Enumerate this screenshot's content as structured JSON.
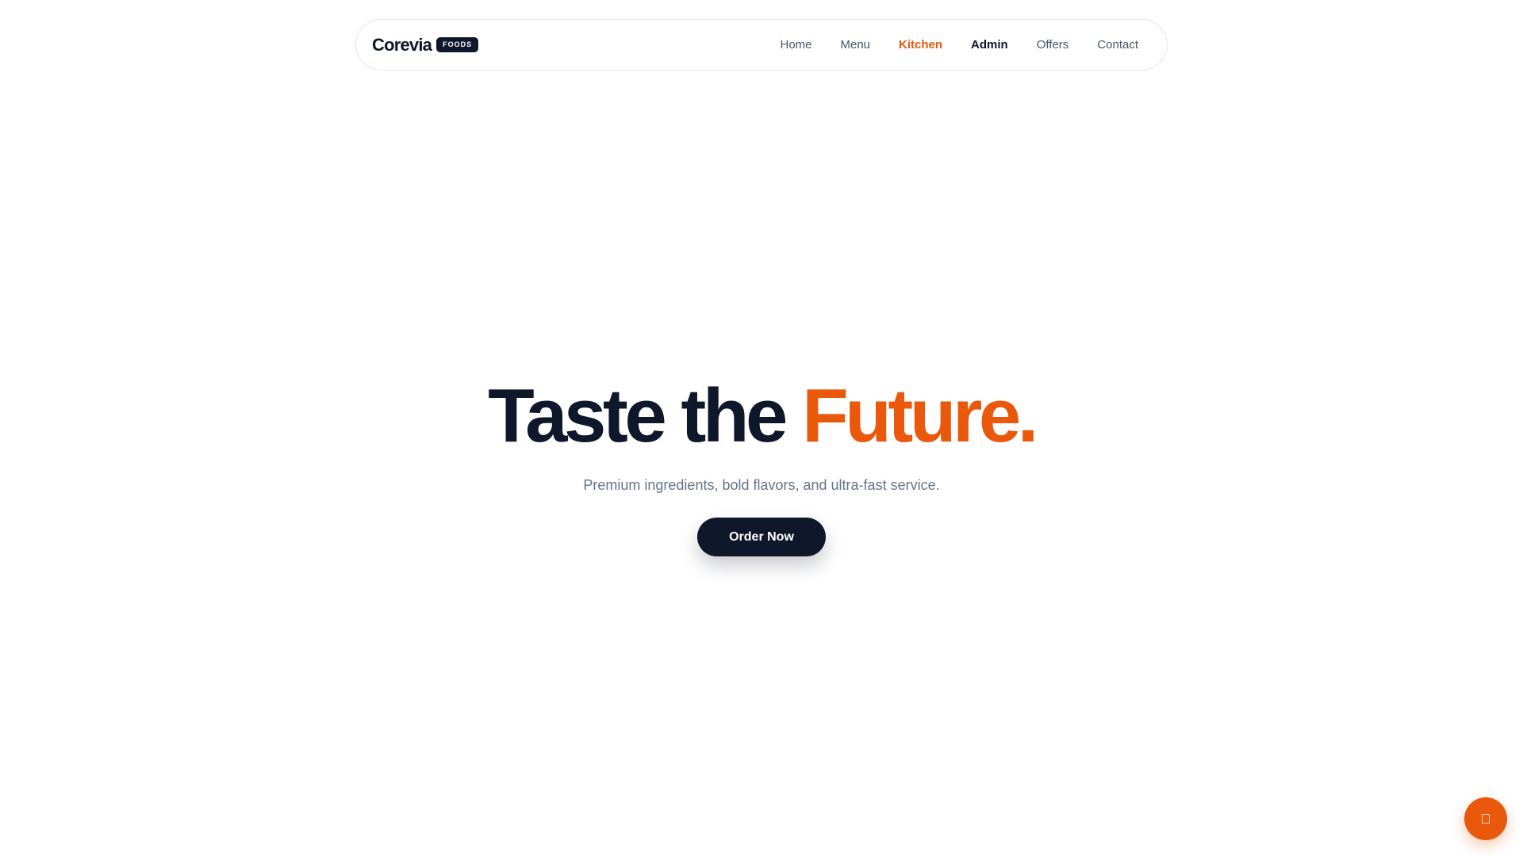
{
  "brand": {
    "name": "Corevia",
    "badge": "FOODS"
  },
  "nav": {
    "items": [
      {
        "label": "Home"
      },
      {
        "label": "Menu"
      },
      {
        "label": "Kitchen"
      },
      {
        "label": "Admin"
      },
      {
        "label": "Offers"
      },
      {
        "label": "Contact"
      }
    ]
  },
  "hero": {
    "title_main": "Taste the",
    "title_accent": "Future.",
    "subtitle": "Premium ingredients, bold flavors, and ultra-fast service.",
    "cta_label": "Order Now"
  },
  "fab": {
    "icon": "chat-icon"
  },
  "colors": {
    "accent": "#ea580c",
    "dark": "#0f172a",
    "muted": "#64748b",
    "nav_text": "#475569",
    "border": "#e5e7eb"
  }
}
